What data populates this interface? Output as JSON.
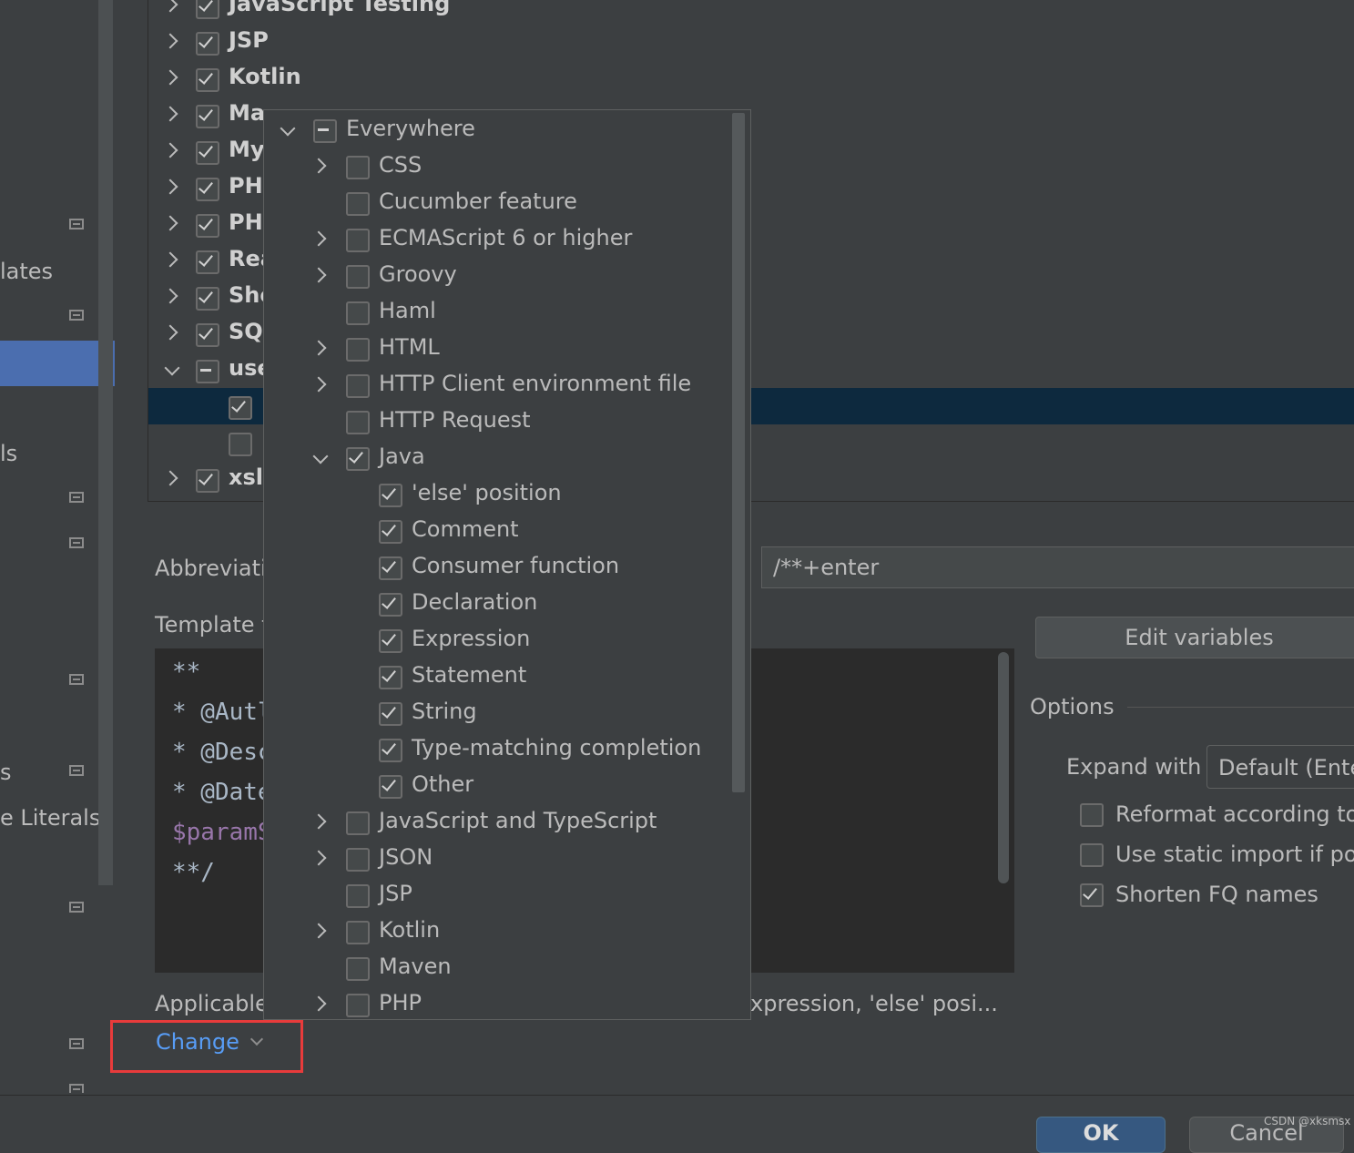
{
  "sidebar": {
    "items": [
      {
        "label": "lates"
      },
      {
        "label": "ls"
      },
      {
        "label": "s"
      },
      {
        "label": "e Literals"
      }
    ]
  },
  "tree": {
    "rows": [
      {
        "label": "JavaScript Testing",
        "state": "checked",
        "expanded": false
      },
      {
        "label": "JSP",
        "state": "checked",
        "expanded": false
      },
      {
        "label": "Kotlin",
        "state": "checked",
        "expanded": false
      },
      {
        "label": "Ma",
        "state": "checked",
        "expanded": false
      },
      {
        "label": "My",
        "state": "checked",
        "expanded": false
      },
      {
        "label": "PHI",
        "state": "checked",
        "expanded": false
      },
      {
        "label": "PHI",
        "state": "checked",
        "expanded": false
      },
      {
        "label": "Rea",
        "state": "checked",
        "expanded": false
      },
      {
        "label": "She",
        "state": "checked",
        "expanded": false
      },
      {
        "label": "SQI",
        "state": "checked",
        "expanded": false
      },
      {
        "label": "use",
        "state": "partial",
        "expanded": true
      },
      {
        "label": "",
        "state": "checked",
        "child": true,
        "selected": true
      },
      {
        "label": "",
        "state": "unchecked",
        "child": true
      },
      {
        "label": "xsl",
        "state": "checked",
        "expanded": false
      }
    ]
  },
  "form": {
    "abbreviation_label": "Abbreviati",
    "abbreviation_value": "/**+enter",
    "template_label": "Template t",
    "template_lines": [
      "**",
      " * @Autl",
      " * @Desc",
      " * @Date",
      " $paramS",
      " **/"
    ],
    "edit_variables": "Edit variables",
    "options_label": "Options",
    "expand_with_label": "Expand with",
    "expand_with_value": "Default (Ente",
    "reformat_label": "Reformat according to",
    "static_import_label": "Use static import if pos",
    "shorten_fq_label": "Shorten FQ names",
    "applicable_label": "Applicable",
    "applicable_value": "xpression, 'else' posi...",
    "change_link": "Change"
  },
  "popup": {
    "items": [
      {
        "label": "Everywhere",
        "state": "partial",
        "arrow": "down",
        "level": 0
      },
      {
        "label": "CSS",
        "state": "unchecked",
        "arrow": "right",
        "level": 1
      },
      {
        "label": "Cucumber feature",
        "state": "unchecked",
        "arrow": "",
        "level": 1
      },
      {
        "label": "ECMAScript 6 or higher",
        "state": "unchecked",
        "arrow": "right",
        "level": 1
      },
      {
        "label": "Groovy",
        "state": "unchecked",
        "arrow": "right",
        "level": 1
      },
      {
        "label": "Haml",
        "state": "unchecked",
        "arrow": "",
        "level": 1
      },
      {
        "label": "HTML",
        "state": "unchecked",
        "arrow": "right",
        "level": 1
      },
      {
        "label": "HTTP Client environment file",
        "state": "unchecked",
        "arrow": "right",
        "level": 1
      },
      {
        "label": "HTTP Request",
        "state": "unchecked",
        "arrow": "",
        "level": 1
      },
      {
        "label": "Java",
        "state": "checked",
        "arrow": "down",
        "level": 1
      },
      {
        "label": "'else' position",
        "state": "checked",
        "arrow": "",
        "level": 2
      },
      {
        "label": "Comment",
        "state": "checked",
        "arrow": "",
        "level": 2
      },
      {
        "label": "Consumer function",
        "state": "checked",
        "arrow": "",
        "level": 2
      },
      {
        "label": "Declaration",
        "state": "checked",
        "arrow": "",
        "level": 2
      },
      {
        "label": "Expression",
        "state": "checked",
        "arrow": "",
        "level": 2
      },
      {
        "label": "Statement",
        "state": "checked",
        "arrow": "",
        "level": 2
      },
      {
        "label": "String",
        "state": "checked",
        "arrow": "",
        "level": 2
      },
      {
        "label": "Type-matching completion",
        "state": "checked",
        "arrow": "",
        "level": 2
      },
      {
        "label": "Other",
        "state": "checked",
        "arrow": "",
        "level": 2
      },
      {
        "label": "JavaScript and TypeScript",
        "state": "unchecked",
        "arrow": "right",
        "level": 1
      },
      {
        "label": "JSON",
        "state": "unchecked",
        "arrow": "right",
        "level": 1
      },
      {
        "label": "JSP",
        "state": "unchecked",
        "arrow": "",
        "level": 1
      },
      {
        "label": "Kotlin",
        "state": "unchecked",
        "arrow": "right",
        "level": 1
      },
      {
        "label": "Maven",
        "state": "unchecked",
        "arrow": "",
        "level": 1
      },
      {
        "label": "PHP",
        "state": "unchecked",
        "arrow": "right",
        "level": 1
      }
    ]
  },
  "footer": {
    "ok_label": "OK",
    "cancel_label": "Cancel",
    "watermark": "CSDN @xksmsx"
  },
  "colors": {
    "background": "#3c3f41",
    "selection": "#0d293e",
    "sidebar_selection": "#4b6eaf",
    "link": "#589df6",
    "highlight_box": "#e83b3b"
  }
}
